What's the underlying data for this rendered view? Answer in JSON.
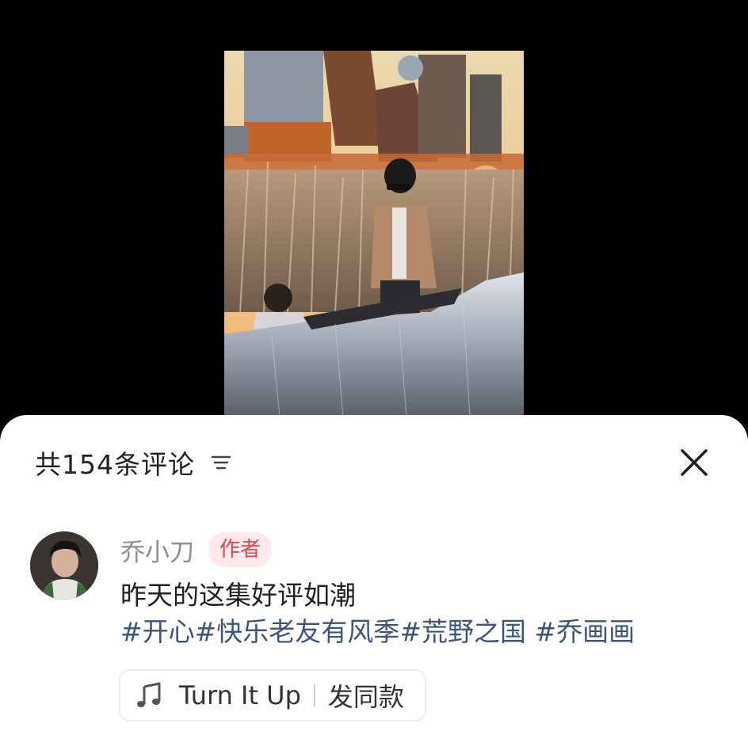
{
  "sheet": {
    "comment_count_label": "共154条评论"
  },
  "comment": {
    "author": "乔小刀",
    "badge": "作者",
    "text": "昨天的这集好评如潮",
    "hashtags": [
      "#开心",
      "#快乐老友有风季",
      "#荒野之国",
      "#乔画画"
    ]
  },
  "music": {
    "title": "Turn It Up",
    "action": "发同款"
  },
  "icons": {
    "sort": "sort-lines-icon",
    "close": "close-x-icon",
    "music": "music-note-icon"
  },
  "colors": {
    "badge_bg": "#fde9ec",
    "badge_text": "#e3424f",
    "hashtag": "#3a5680"
  }
}
